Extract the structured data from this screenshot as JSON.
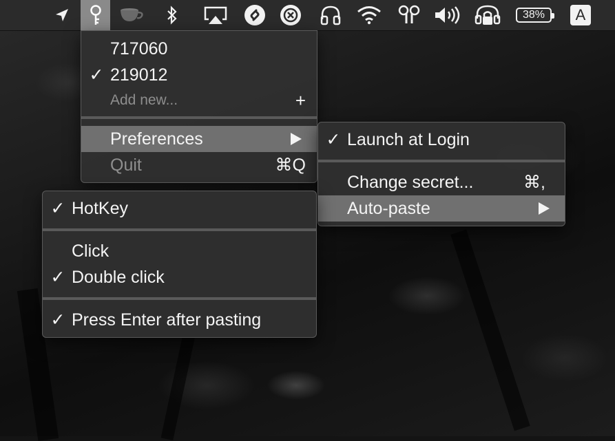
{
  "menubar": {
    "icons": [
      "location-arrow-icon",
      "key-icon",
      "coffee-cup-icon",
      "bluetooth-icon",
      "airplay-icon",
      "shazam-icon",
      "close-circle-icon",
      "headphones-icon",
      "wifi-icon",
      "airpods-icon",
      "volume-icon",
      "lock-headphones-icon",
      "battery-icon",
      "input-source-icon"
    ],
    "battery_text": "38%",
    "input_source": "A"
  },
  "main_menu": {
    "codes": [
      {
        "value": "717060",
        "checked": false
      },
      {
        "value": "219012",
        "checked": true
      }
    ],
    "add_new_label": "Add new...",
    "add_new_shortcut": "+",
    "preferences_label": "Preferences",
    "quit_label": "Quit",
    "quit_shortcut": "⌘Q"
  },
  "preferences_menu": {
    "launch_at_login_label": "Launch at Login",
    "launch_at_login_checked": true,
    "change_secret_label": "Change secret...",
    "change_secret_shortcut": "⌘,",
    "auto_paste_label": "Auto-paste"
  },
  "autopaste_menu": {
    "hotkey_label": "HotKey",
    "click_label": "Click",
    "double_click_label": "Double click",
    "press_enter_label": "Press Enter after pasting"
  },
  "check_glyph": "✓"
}
